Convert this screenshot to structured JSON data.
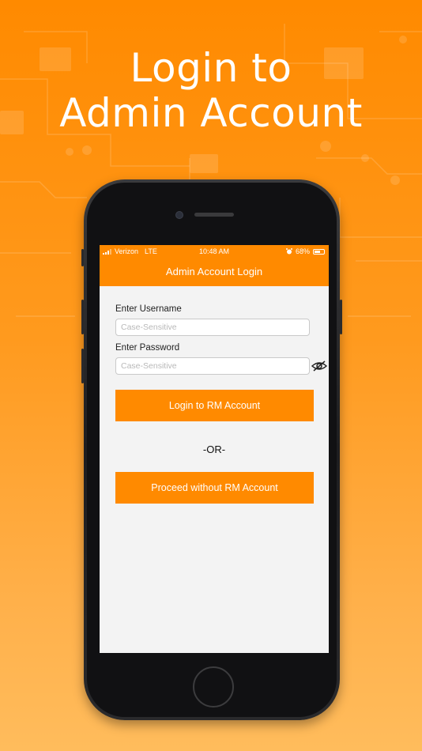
{
  "promo": {
    "headline_line1": "Login to",
    "headline_line2": "Admin Account"
  },
  "status_bar": {
    "carrier": "Verizon",
    "network": "LTE",
    "time": "10:48 AM",
    "battery": "68%",
    "battery_level": 0.68
  },
  "nav": {
    "title": "Admin Account Login"
  },
  "form": {
    "username_label": "Enter Username",
    "username_placeholder": "Case-Sensitive",
    "password_label": "Enter Password",
    "password_placeholder": "Case-Sensitive"
  },
  "buttons": {
    "login_label": "Login to RM Account",
    "or_text": "-OR-",
    "proceed_label": "Proceed without RM Account"
  },
  "colors": {
    "accent": "#ff8a00",
    "screen_background": "#f3f3f3"
  }
}
